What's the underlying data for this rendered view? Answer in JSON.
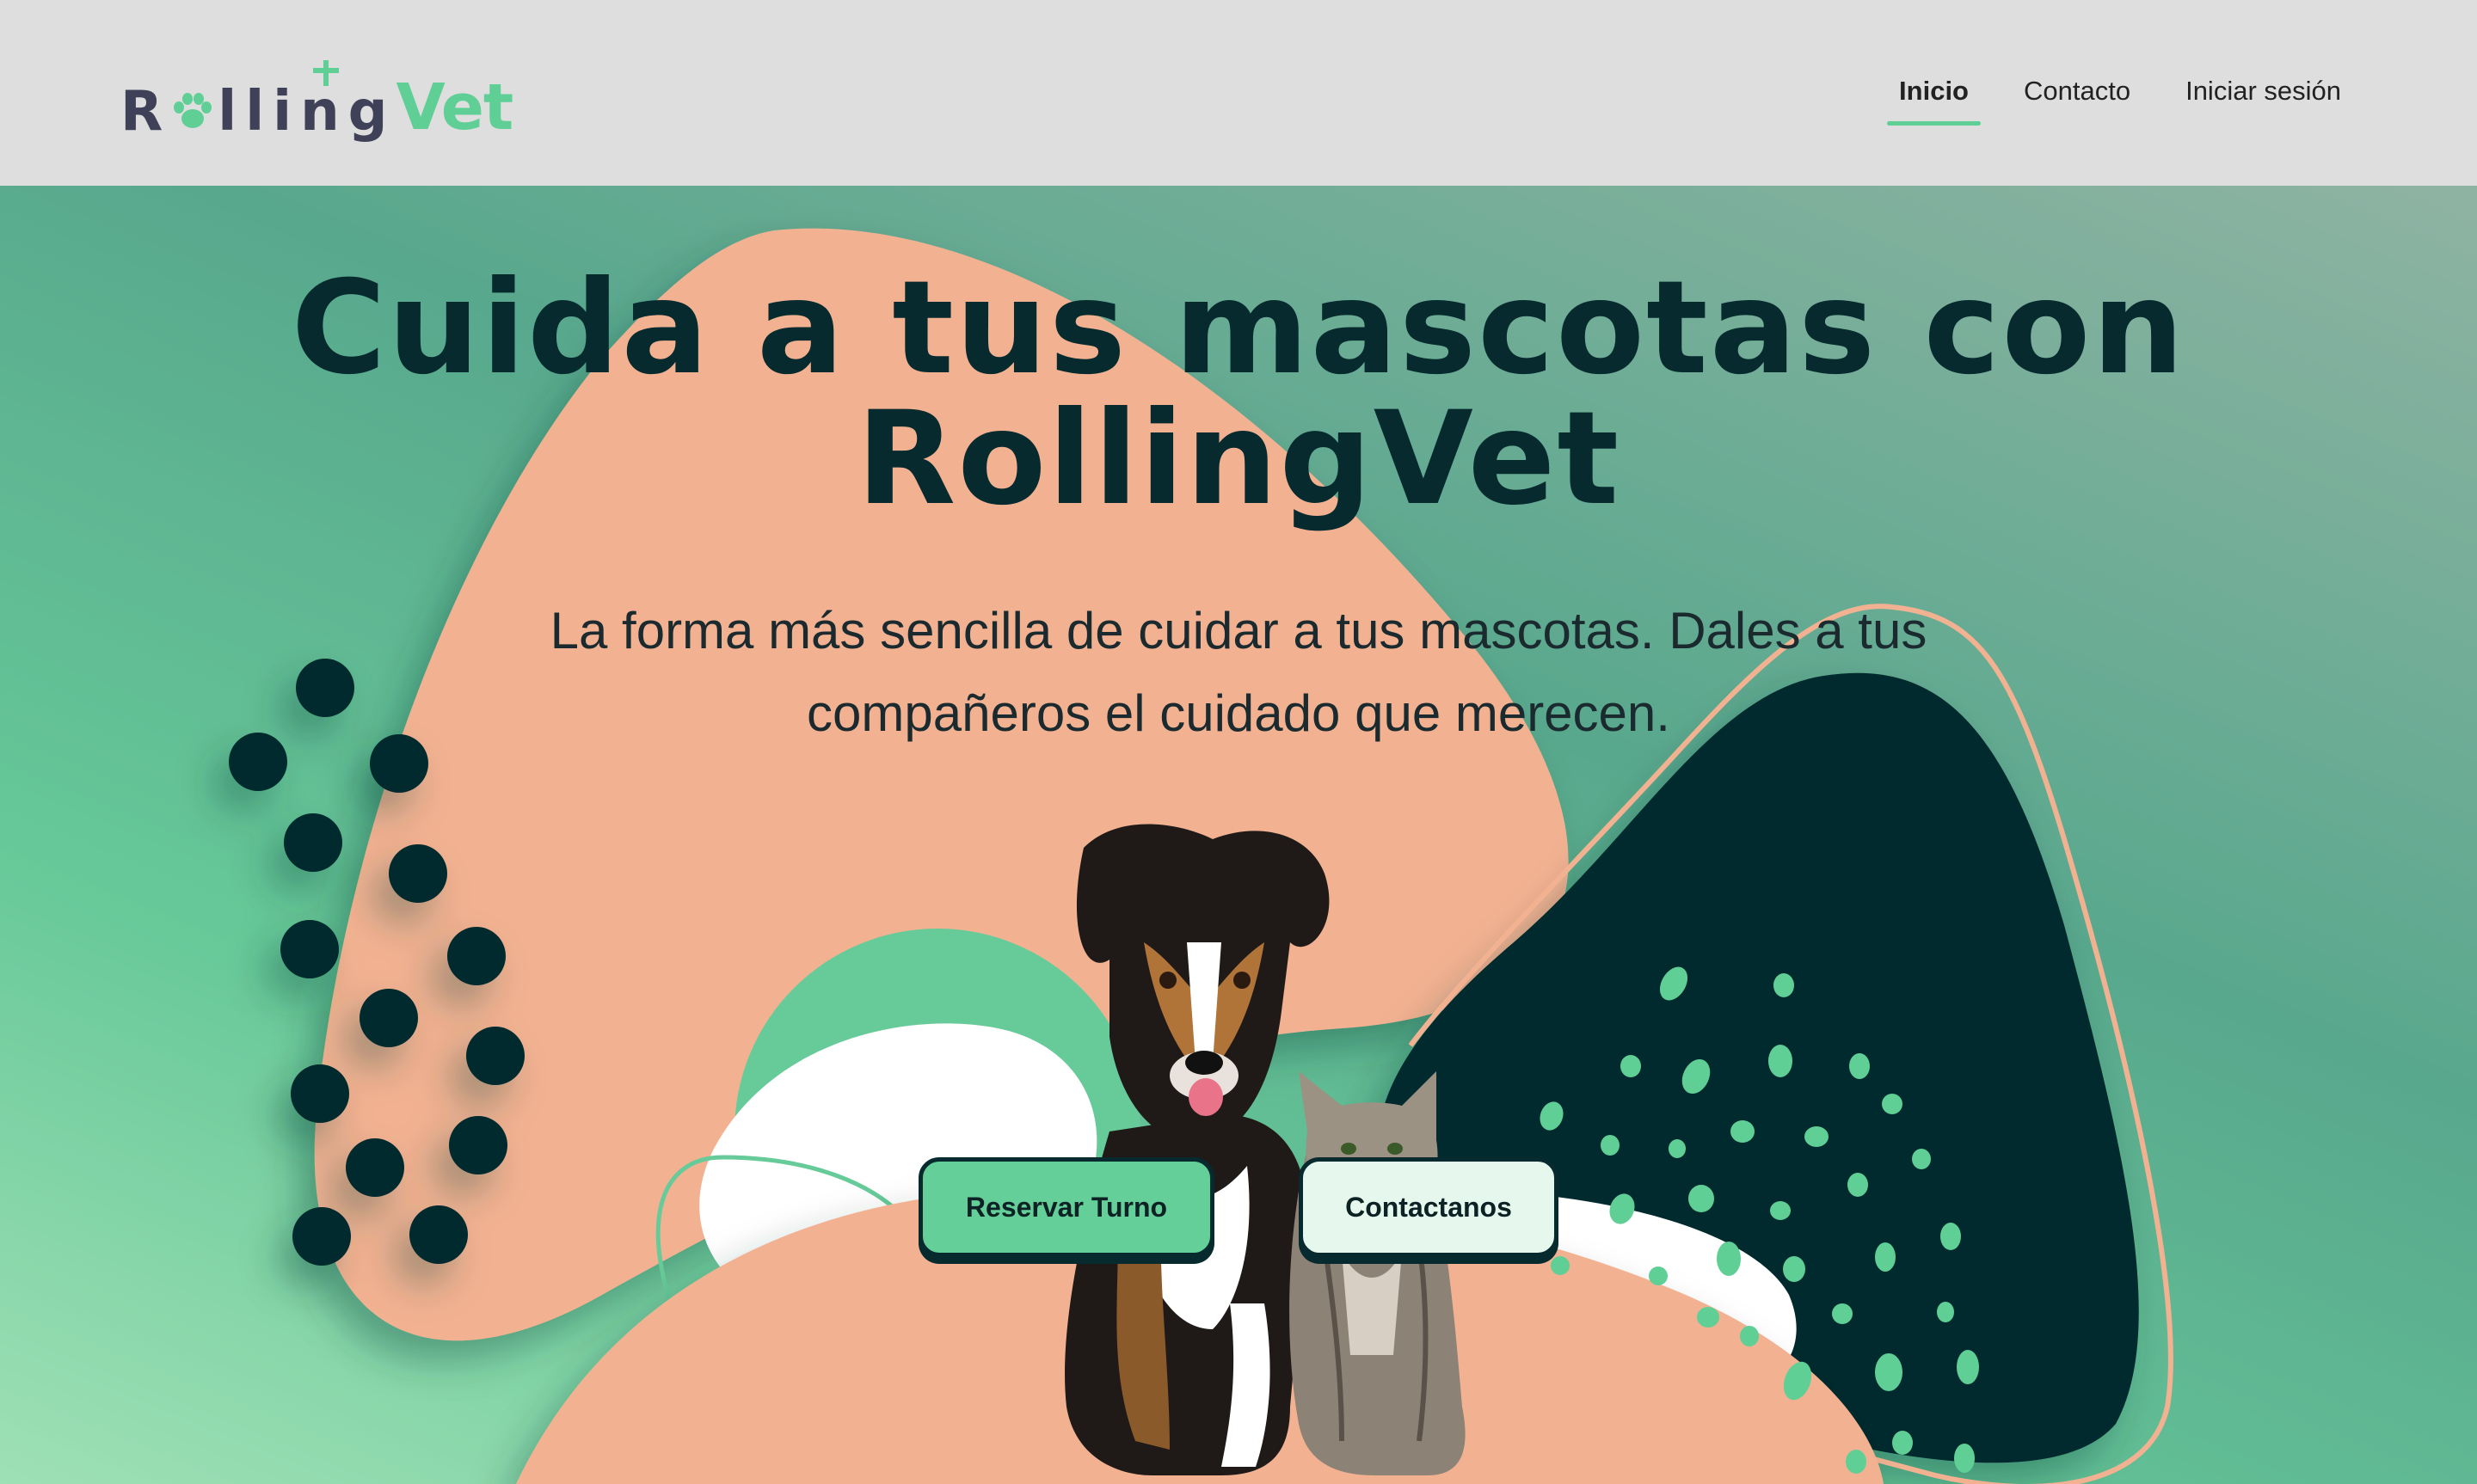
{
  "logo": {
    "part1": "Rolling",
    "part2": "Vet"
  },
  "nav": {
    "items": [
      {
        "label": "Inicio",
        "active": true
      },
      {
        "label": "Contacto",
        "active": false
      },
      {
        "label": "Iniciar sesión",
        "active": false
      }
    ]
  },
  "hero": {
    "title": "Cuida a tus mascotas con RollingVet",
    "subtitle": "La forma más sencilla de cuidar a tus mascotas. Dales a tus compañeros el cuidado que merecen.",
    "primary_button": "Reservar Turno",
    "secondary_button": "Contactanos"
  },
  "colors": {
    "navbar_bg": "#dedede",
    "brand_green": "#5fcf96",
    "brand_dark": "#062a2e",
    "peach": "#f2b292",
    "logo_text": "#3e4158"
  },
  "icons": [
    "paw-icon",
    "plus-cross-icon"
  ]
}
